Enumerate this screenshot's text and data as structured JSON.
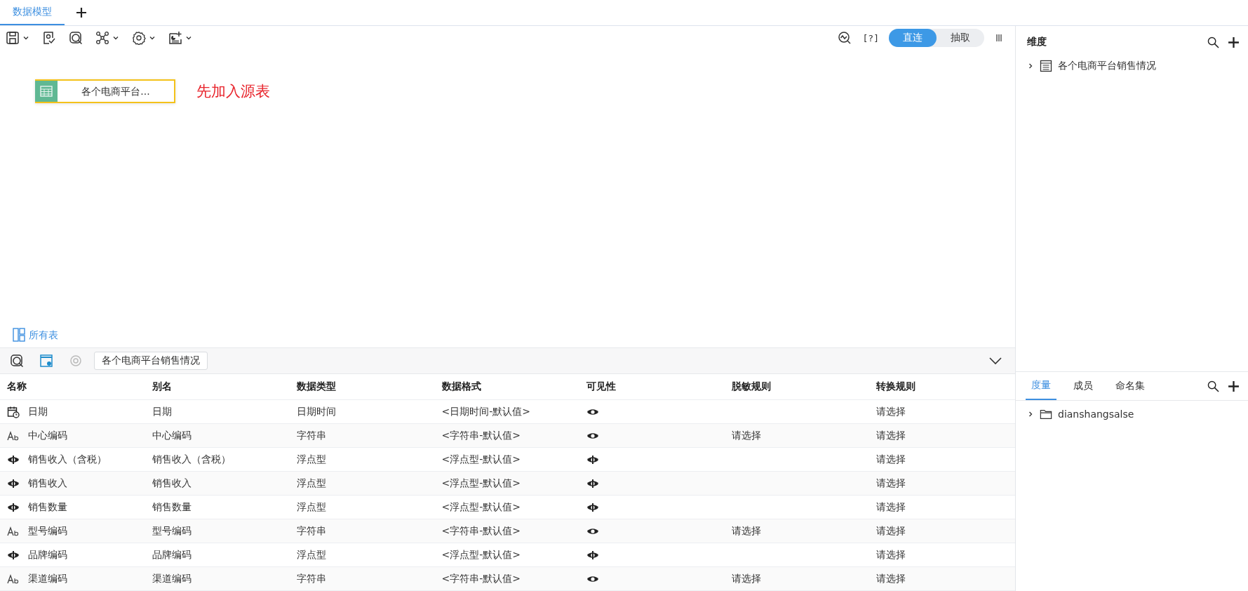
{
  "tabs": [
    {
      "label": "数据模型",
      "selected": true
    }
  ],
  "toolbar": {
    "mode_options": [
      {
        "label": "直连",
        "selected": true
      },
      {
        "label": "抽取",
        "selected": false
      }
    ],
    "help": "[?]"
  },
  "canvas": {
    "nodes": [
      {
        "label": "各个电商平台..."
      }
    ],
    "annotation": "先加入源表",
    "all_tables": "所有表"
  },
  "table_panel": {
    "table_name": "各个电商平台销售情况",
    "columns": [
      "名称",
      "别名",
      "数据类型",
      "数据格式",
      "可见性",
      "脱敏规则",
      "转换规则"
    ],
    "rows": [
      {
        "kind": "date",
        "name": "日期",
        "alias": "日期",
        "data_type": "日期时间",
        "format": "<日期时间-默认值>",
        "visibility": {
          "kind": "eye"
        },
        "mask_rule": "",
        "convert_rule": "请选择"
      },
      {
        "kind": "text",
        "name": "中心编码",
        "alias": "中心编码",
        "data_type": "字符串",
        "format": "<字符串-默认值>",
        "visibility": {
          "kind": "eye"
        },
        "mask_rule": "请选择",
        "convert_rule": "请选择"
      },
      {
        "kind": "number",
        "name": "销售收入（含税）",
        "alias": "销售收入（含税）",
        "data_type": "浮点型",
        "format": "<浮点型-默认值>",
        "visibility": {
          "kind": "measure"
        },
        "mask_rule": "",
        "convert_rule": "请选择"
      },
      {
        "kind": "number",
        "name": "销售收入",
        "alias": "销售收入",
        "data_type": "浮点型",
        "format": "<浮点型-默认值>",
        "visibility": {
          "kind": "measure"
        },
        "mask_rule": "",
        "convert_rule": "请选择"
      },
      {
        "kind": "number",
        "name": "销售数量",
        "alias": "销售数量",
        "data_type": "浮点型",
        "format": "<浮点型-默认值>",
        "visibility": {
          "kind": "measure"
        },
        "mask_rule": "",
        "convert_rule": "请选择"
      },
      {
        "kind": "text",
        "name": "型号编码",
        "alias": "型号编码",
        "data_type": "字符串",
        "format": "<字符串-默认值>",
        "visibility": {
          "kind": "eye"
        },
        "mask_rule": "请选择",
        "convert_rule": "请选择"
      },
      {
        "kind": "number",
        "name": "品牌编码",
        "alias": "品牌编码",
        "data_type": "浮点型",
        "format": "<浮点型-默认值>",
        "visibility": {
          "kind": "measure"
        },
        "mask_rule": "",
        "convert_rule": "请选择"
      },
      {
        "kind": "text",
        "name": "渠道编码",
        "alias": "渠道编码",
        "data_type": "字符串",
        "format": "<字符串-默认值>",
        "visibility": {
          "kind": "eye"
        },
        "mask_rule": "请选择",
        "convert_rule": "请选择"
      }
    ]
  },
  "dimension_panel": {
    "title": "维度",
    "items": [
      {
        "label": "各个电商平台销售情况",
        "expanded": false
      }
    ]
  },
  "measure_panel": {
    "tabs": [
      {
        "label": "度量",
        "selected": true
      },
      {
        "label": "成员",
        "selected": false
      },
      {
        "label": "命名集",
        "selected": false
      }
    ],
    "items": [
      {
        "label": "dianshangsalse",
        "expanded": false
      }
    ]
  }
}
